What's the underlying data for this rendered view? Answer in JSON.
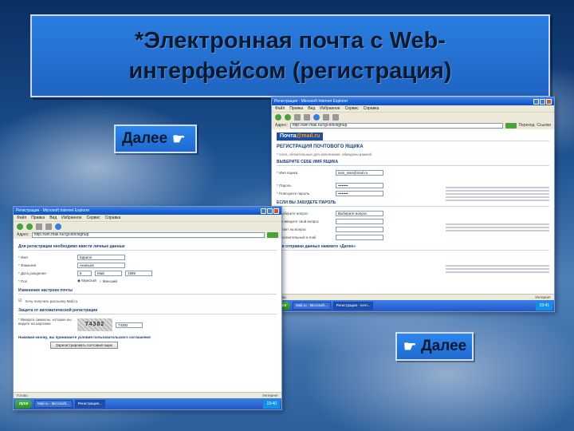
{
  "title": {
    "line1": "*Электронная почта с Web-",
    "line2": "интерфейсом (регистрация)"
  },
  "next_label": "Далее",
  "big_window": {
    "titlebar": "Регистрация - Microsoft Internet Explorer",
    "menu": [
      "Файл",
      "Правка",
      "Вид",
      "Избранное",
      "Сервис",
      "Справка"
    ],
    "address_label": "Адрес:",
    "address": "http://win.mail.ru/cgi-bin/signup",
    "go_label": "Переход",
    "links_label": "Ссылки",
    "logo_main": "Почта",
    "logo_suffix": "@mail.ru",
    "heading": "РЕГИСТРАЦИЯ ПОЧТОВОГО ЯЩИКА",
    "required_note": "* поля, обязательные для заполнения, обведены рамкой",
    "section_mailbox": "ВЫБЕРИТЕ СЕБЕ ИМЯ ЯЩИКА",
    "field_name_label": "* Имя ящика",
    "field_name_value": "ivan_ivan@mail.ru",
    "field_password_label": "* Пароль",
    "field_password_value": "••••••••",
    "field_password_repeat_label": "* Повторите пароль",
    "field_password_repeat_value": "••••••••",
    "section_password": "ЕСЛИ ВЫ ЗАБУДЕТЕ ПАРОЛЬ",
    "field_question_label": "* Выберите вопрос",
    "field_question_value": "Выберите вопрос",
    "field_own_question_label": "Или введите свой вопрос",
    "field_answer_label": "* Ответ на вопрос",
    "field_extra_email_label": "Дополнительный e-mail",
    "section_bottom": "Для отправки данных нажмите «Далее»",
    "status": "Готово",
    "zone": "Интернет",
    "tasks": [
      "Mail.ru - Microsoft...",
      "Регистрация - почт..."
    ],
    "start": "пуск",
    "clock": "19:41"
  },
  "small_window": {
    "titlebar": "Регистрация - Microsoft Internet Explorer",
    "menu": [
      "Файл",
      "Правка",
      "Вид",
      "Избранное",
      "Сервис",
      "Справка"
    ],
    "address_label": "Адрес:",
    "address": "http://win.mail.ru/cgi-bin/signup",
    "section_personal": "Для регистрации необходимо ввести личные данные",
    "field_firstname_label": "* Имя",
    "field_firstname_value": "Кирилл",
    "field_lastname_label": "* Фамилия",
    "field_lastname_value": "Ананьев",
    "field_birthdate_label": "* Дата рождения",
    "field_birthdate_day": "5",
    "field_birthdate_month": "Май",
    "field_birthdate_year": "1989",
    "field_gender_label": "* Пол",
    "gender_male": "Мужской",
    "gender_female": "Женский",
    "section_other": "Изменение настроек почты",
    "checkbox_note": "Хочу получать рассылку Mail.ru",
    "section_captcha": "Защита от автоматической регистрации",
    "captcha_label": "* Введите символы, которые вы видите на картинке",
    "captcha_code": "74382",
    "captcha_value": "74382",
    "agreement_text": "Нажимая кнопку, вы принимаете условия пользовательского соглашения",
    "submit_label": "Зарегистрировать почтовый ящик",
    "status": "Готово",
    "zone": "Интернет",
    "start": "пуск",
    "tasks": [
      "Mail.ru - Microsoft...",
      "Регистрация..."
    ],
    "clock": "19:40"
  }
}
